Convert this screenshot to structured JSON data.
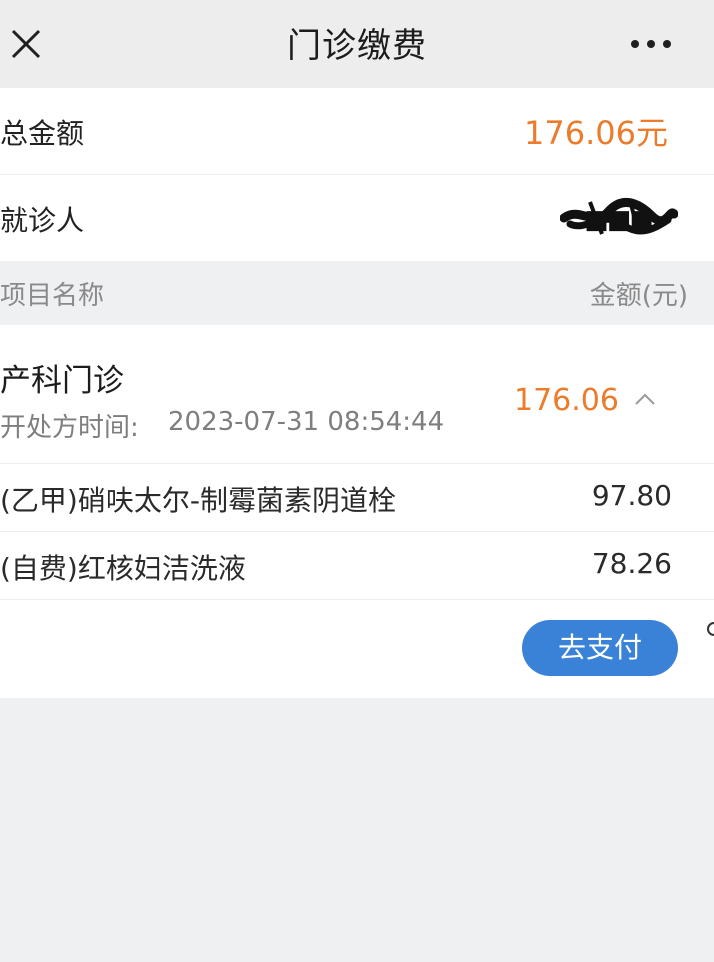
{
  "nav": {
    "title": "门诊缴费",
    "close_icon": "close-icon",
    "more_icon": "more-icon"
  },
  "summary": {
    "total_label": "总金额",
    "total_value": "176.06元",
    "patient_label": "就诊人",
    "patient_name": "■■■"
  },
  "table_header": {
    "name_col": "项目名称",
    "amount_col": "金额(元)"
  },
  "department": {
    "name": "产科门诊",
    "time_label": "开处方时间:",
    "time_value": "2023-07-31 08:54:44",
    "amount": "176.06",
    "toggle_icon": "chevron-up-icon"
  },
  "items": [
    {
      "name": "(乙甲)硝呋太尔-制霉菌素阴道栓",
      "price": "97.80"
    },
    {
      "name": "(自费)红核妇洁洗液",
      "price": "78.26"
    }
  ],
  "actions": {
    "pay_label": "去支付"
  },
  "colors": {
    "accent_orange": "#ec7c2b",
    "button_blue": "#3a82d8",
    "page_bg": "#eff0f2"
  }
}
